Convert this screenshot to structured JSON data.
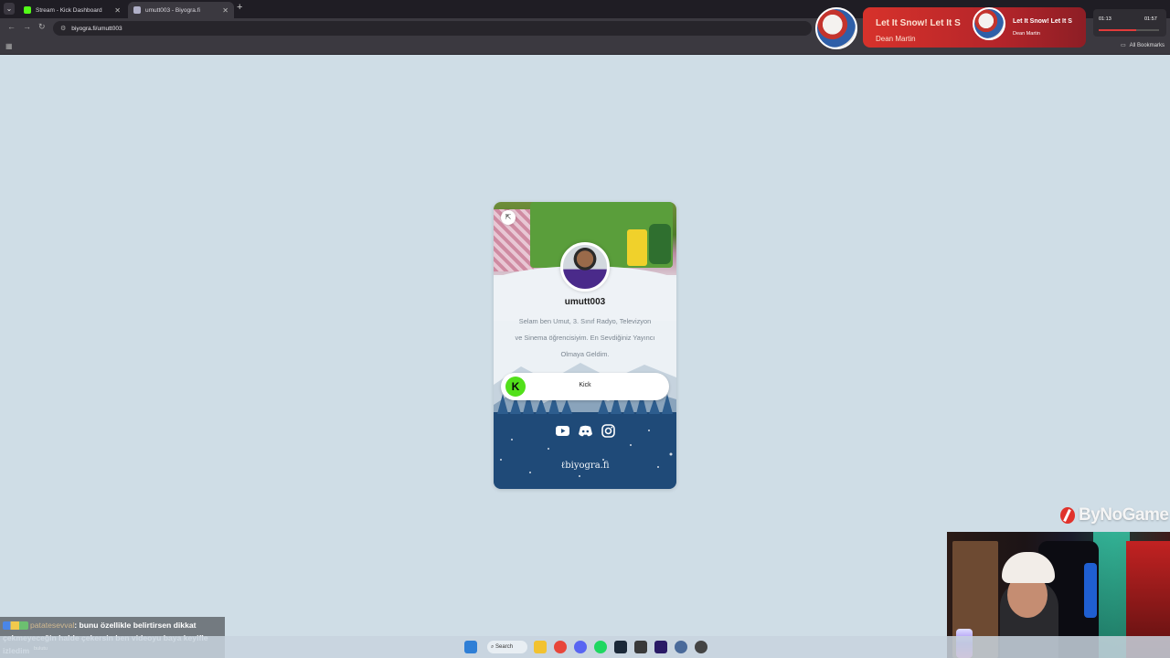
{
  "browser": {
    "tabs": [
      {
        "label": "Stream - Kick Dashboard",
        "favicon_color": "#53fc18",
        "favicon": "kick-icon"
      },
      {
        "label": "umutt003 - Biyogra.fi",
        "favicon_color": "#b0b0c8",
        "favicon": "biyografi-icon"
      }
    ],
    "url": "biyogra.fi/umutt003",
    "all_bookmarks": "All Bookmarks"
  },
  "now_playing": {
    "song": "Let It Snow! Let It S",
    "artist": "Dean Martin",
    "song_small": "Let It Snow! Let It S",
    "artist_small": "Dean Martin",
    "elapsed": "01:13",
    "total": "01:57"
  },
  "profile": {
    "username": "umutt003",
    "bio_lines": [
      "Selam ben Umut, 3. Sınıf Radyo, Televizyon",
      "ve Sinema öğrencisiyim. En Sevdiğiniz Yayıncı",
      "Olmaya Geldim."
    ],
    "link_label": "Kick",
    "social_icons": [
      "youtube-icon",
      "discord-icon",
      "instagram-icon"
    ],
    "brand": "biyogra.fi"
  },
  "overlay": {
    "sponsor": "ByNoGame",
    "chat_user": "patatesevval",
    "chat_text": ": bunu özellikle belirtirsen dikkat çekmeyeceğin halde çekersin ben videoyu baya keyifle izledim",
    "chat_sub": "bulutu"
  },
  "taskbar": {
    "search_label": "Search"
  },
  "colors": {
    "page_bg": "#cfdde6",
    "card_bottom": "#1f4a78",
    "kick_green": "#52e01a",
    "now_playing_red": "#d7322b"
  }
}
